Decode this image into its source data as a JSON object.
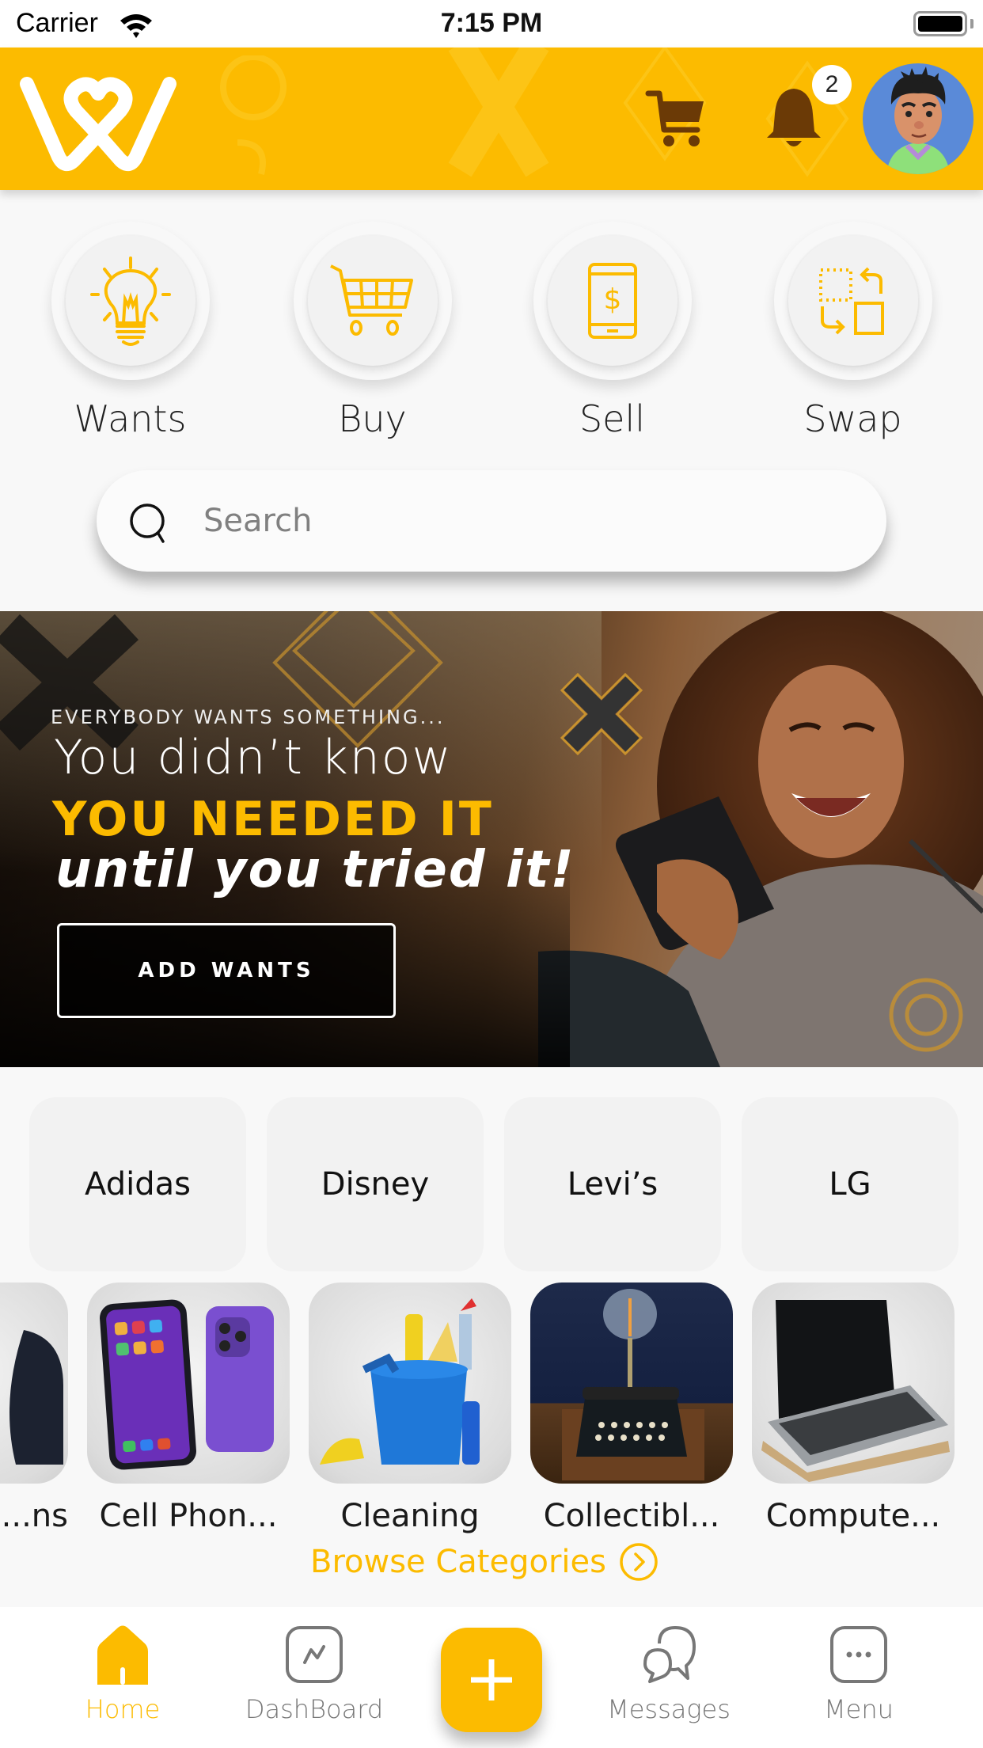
{
  "status_bar": {
    "carrier": "Carrier",
    "time": "7:15 PM"
  },
  "header": {
    "logo": "wants-heart-logo",
    "icons": [
      "cart-icon",
      "bell-icon"
    ],
    "notification_count": "2",
    "avatar": "user-avatar"
  },
  "quick_actions": [
    {
      "label": "Wants",
      "icon": "lightbulb-icon"
    },
    {
      "label": "Buy",
      "icon": "shopping-cart-icon"
    },
    {
      "label": "Sell",
      "icon": "phone-dollar-icon"
    },
    {
      "label": "Swap",
      "icon": "swap-icon"
    }
  ],
  "search": {
    "placeholder": "Search",
    "value": ""
  },
  "banner": {
    "kicker": "EVERYBODY WANTS SOMETHING...",
    "line1": "You didn’t know",
    "line2": "YOU NEEDED IT",
    "line3": "until you tried it!",
    "button_label": "ADD WANTS"
  },
  "brands": [
    "Adidas",
    "Disney",
    "Levi’s",
    "LG"
  ],
  "categories": [
    {
      "label": "...ns",
      "image": "camera-photo"
    },
    {
      "label": "Cell Phon...",
      "image": "cell-phones-photo"
    },
    {
      "label": "Cleaning",
      "image": "cleaning-supplies-photo"
    },
    {
      "label": "Collectibl...",
      "image": "typewriter-lamp-photo"
    },
    {
      "label": "Compute...",
      "image": "laptop-photo"
    }
  ],
  "browse_categories": "Browse Categories",
  "tabbar": {
    "tabs": [
      {
        "label": "Home",
        "icon": "home-icon",
        "active": true
      },
      {
        "label": "DashBoard",
        "icon": "dashboard-icon",
        "active": false
      },
      {
        "label": "Messages",
        "icon": "messages-icon",
        "active": false
      },
      {
        "label": "Menu",
        "icon": "menu-dots-icon",
        "active": false
      }
    ],
    "fab_icon": "plus-icon"
  },
  "colors": {
    "accent": "#fcbb00",
    "header_icon": "#6b3a06",
    "background": "#f8f8f8"
  }
}
